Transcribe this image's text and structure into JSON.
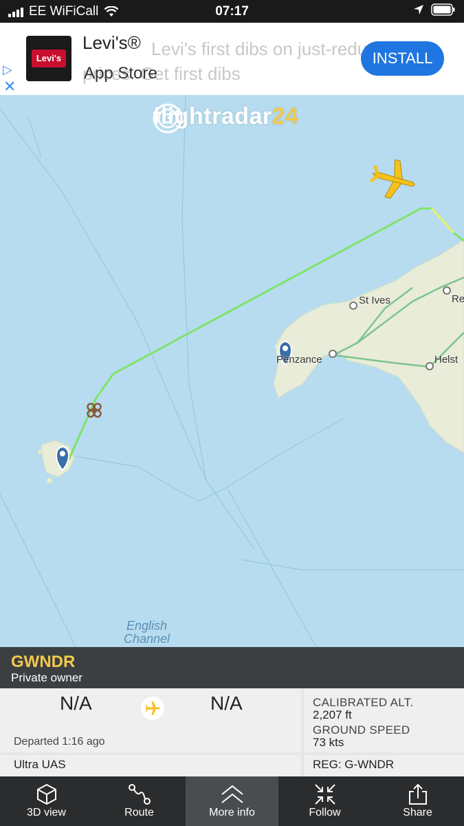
{
  "status_bar": {
    "carrier": "EE WiFiCall",
    "time": "07:17"
  },
  "ad": {
    "title": "Levi's®",
    "subtitle": "App Store",
    "background_text_line1": "Levi's first dibs on just-reduced",
    "background_text_line2": "prices. Get first dibs",
    "logo_text": "Levi's",
    "install_label": "INSTALL"
  },
  "map": {
    "logo_text": "flightradar",
    "logo_number": "24",
    "places": [
      "St Ives",
      "Penzance",
      "Re",
      "Helst"
    ],
    "sea_label_line1": "English",
    "sea_label_line2": "Channel"
  },
  "flight": {
    "callsign": "GWNDR",
    "owner": "Private owner",
    "origin": "N/A",
    "destination": "N/A",
    "departed": "Departed 1:16 ago",
    "aircraft_type": "Ultra UAS",
    "altitude_label": "CALIBRATED ALT.",
    "altitude_value": "2,207 ft",
    "speed_label": "GROUND SPEED",
    "speed_value": "73 kts",
    "registration": "REG: G-WNDR"
  },
  "nav": {
    "items": [
      "3D view",
      "Route",
      "More info",
      "Follow",
      "Share"
    ]
  },
  "colors": {
    "accent": "#f2c94c",
    "track": "#7fe36a",
    "sea": "#b7dcef",
    "land": "#e9ecd8"
  }
}
